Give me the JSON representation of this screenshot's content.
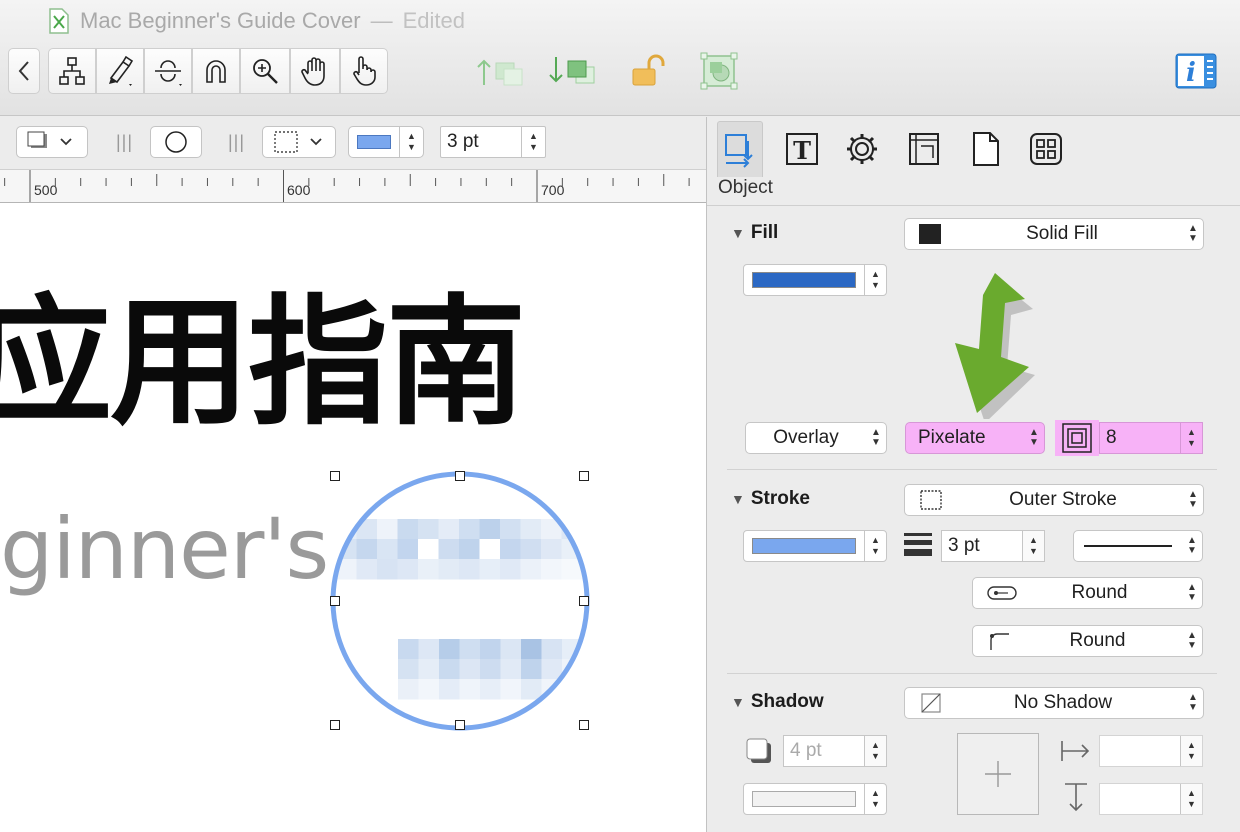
{
  "window": {
    "title": "Mac Beginner's Guide Cover",
    "separator": "—",
    "status": "Edited"
  },
  "toolbar": {
    "tools": [
      "back-icon",
      "diagram-tree-icon",
      "style-brush-icon",
      "magnet-line-icon",
      "magnet-icon",
      "zoom-icon",
      "hand-pan-icon",
      "browse-hand-icon"
    ],
    "arrange": [
      "bring-forward-icon",
      "send-backward-icon",
      "unlock-icon",
      "group-mask-icon"
    ],
    "inspector_icon": "info-icon"
  },
  "formatbar": {
    "stroke_width": "3 pt",
    "stroke_color": "#7aa7ee"
  },
  "ruler": {
    "labels": [
      "500",
      "600",
      "700"
    ]
  },
  "canvas": {
    "heading": "应用指南",
    "subtitle": "ginner's"
  },
  "inspector": {
    "tabs": [
      "object-tab-icon",
      "text-tab-icon",
      "properties-gear-icon",
      "canvas-tab-icon",
      "document-tab-icon",
      "stencils-tab-icon"
    ],
    "panel_title": "Object",
    "fill": {
      "label": "Fill",
      "type": "Solid Fill",
      "color": "#2b68c4",
      "blend_mode": "Overlay",
      "effect": "Pixelate",
      "effect_amount": "8"
    },
    "stroke": {
      "label": "Stroke",
      "type": "Outer Stroke",
      "color": "#7aa7ee",
      "width": "3 pt",
      "cap": "Round",
      "join": "Round"
    },
    "shadow": {
      "label": "Shadow",
      "type": "No Shadow",
      "size": "4 pt"
    }
  },
  "colors": {
    "highlight": "#f7b2f7",
    "arrow": "#6aaa2e",
    "selection": "#7aa7ee",
    "accent": "#2d7fd8"
  }
}
